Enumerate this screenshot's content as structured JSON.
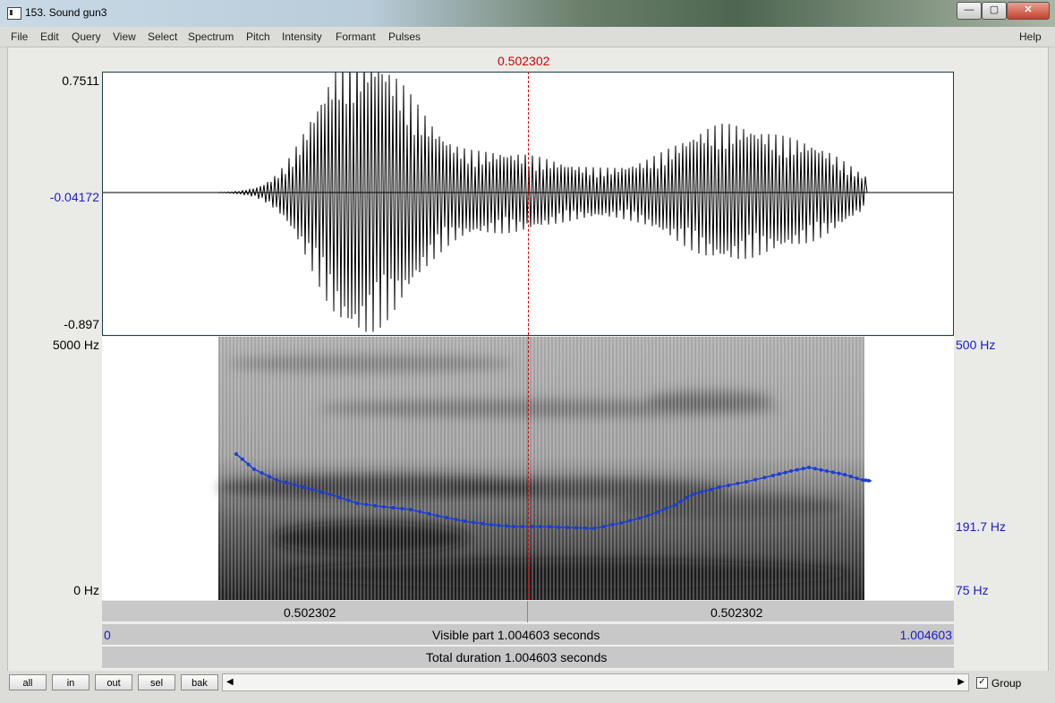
{
  "window": {
    "title": "153. Sound gun3",
    "minimize": "—",
    "maximize": "▢",
    "close": "✕"
  },
  "menu": {
    "items": [
      "File",
      "Edit",
      "Query",
      "View",
      "Select",
      "Spectrum",
      "Pitch",
      "Intensity",
      "Formant",
      "Pulses"
    ],
    "help": "Help"
  },
  "cursor": {
    "time_label": "0.502302",
    "time_s": 0.502302
  },
  "waveform": {
    "max_label": "0.7511",
    "zero_label": "-0.04172",
    "min_label": "-0.897"
  },
  "spectrogram": {
    "top_label": "5000 Hz",
    "bottom_label": "0 Hz"
  },
  "pitch": {
    "top_label": "500 Hz",
    "mid_label": "191.7 Hz",
    "bottom_label": "75 Hz",
    "color": "#1a3fd6"
  },
  "timebar": {
    "left_label": "0.502302",
    "right_label": "0.502302",
    "visible_start": "0",
    "visible_text": "Visible part 1.004603 seconds",
    "visible_end": "1.004603",
    "total_text": "Total duration 1.004603 seconds"
  },
  "nav": {
    "all": "all",
    "in": "in",
    "out": "out",
    "sel": "sel",
    "bak": "bak",
    "left_arrow": "◀",
    "right_arrow": "▶",
    "group_label": "Group",
    "group_checked": "✓"
  }
}
